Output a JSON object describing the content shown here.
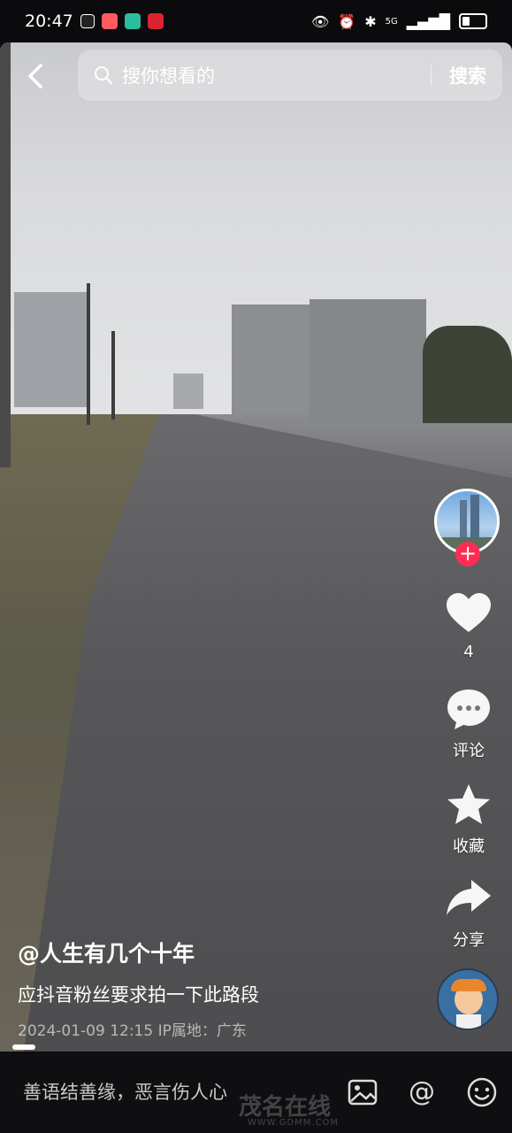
{
  "status_bar": {
    "time": "20:47",
    "app_icons": [
      "douyin-icon",
      "red-app-icon",
      "boss-app-icon",
      "pattern-app-icon"
    ],
    "network": "5G"
  },
  "search": {
    "placeholder": "搜你想看的",
    "button_label": "搜索"
  },
  "actions": {
    "likes_count": "4",
    "comment_label": "评论",
    "favorite_label": "收藏",
    "share_label": "分享"
  },
  "post": {
    "author": "@人生有几个十年",
    "description": "应抖音粉丝要求拍一下此路段",
    "meta": "2024-01-09 12:15  IP属地：广东"
  },
  "bottom": {
    "comment_placeholder": "善语结善缘，恶言伤人心"
  },
  "watermark": {
    "text": "茂名在线",
    "url": "WWW.GDMM.COM"
  },
  "colors": {
    "follow": "#fe2c55",
    "background": "#0b0b0d"
  }
}
